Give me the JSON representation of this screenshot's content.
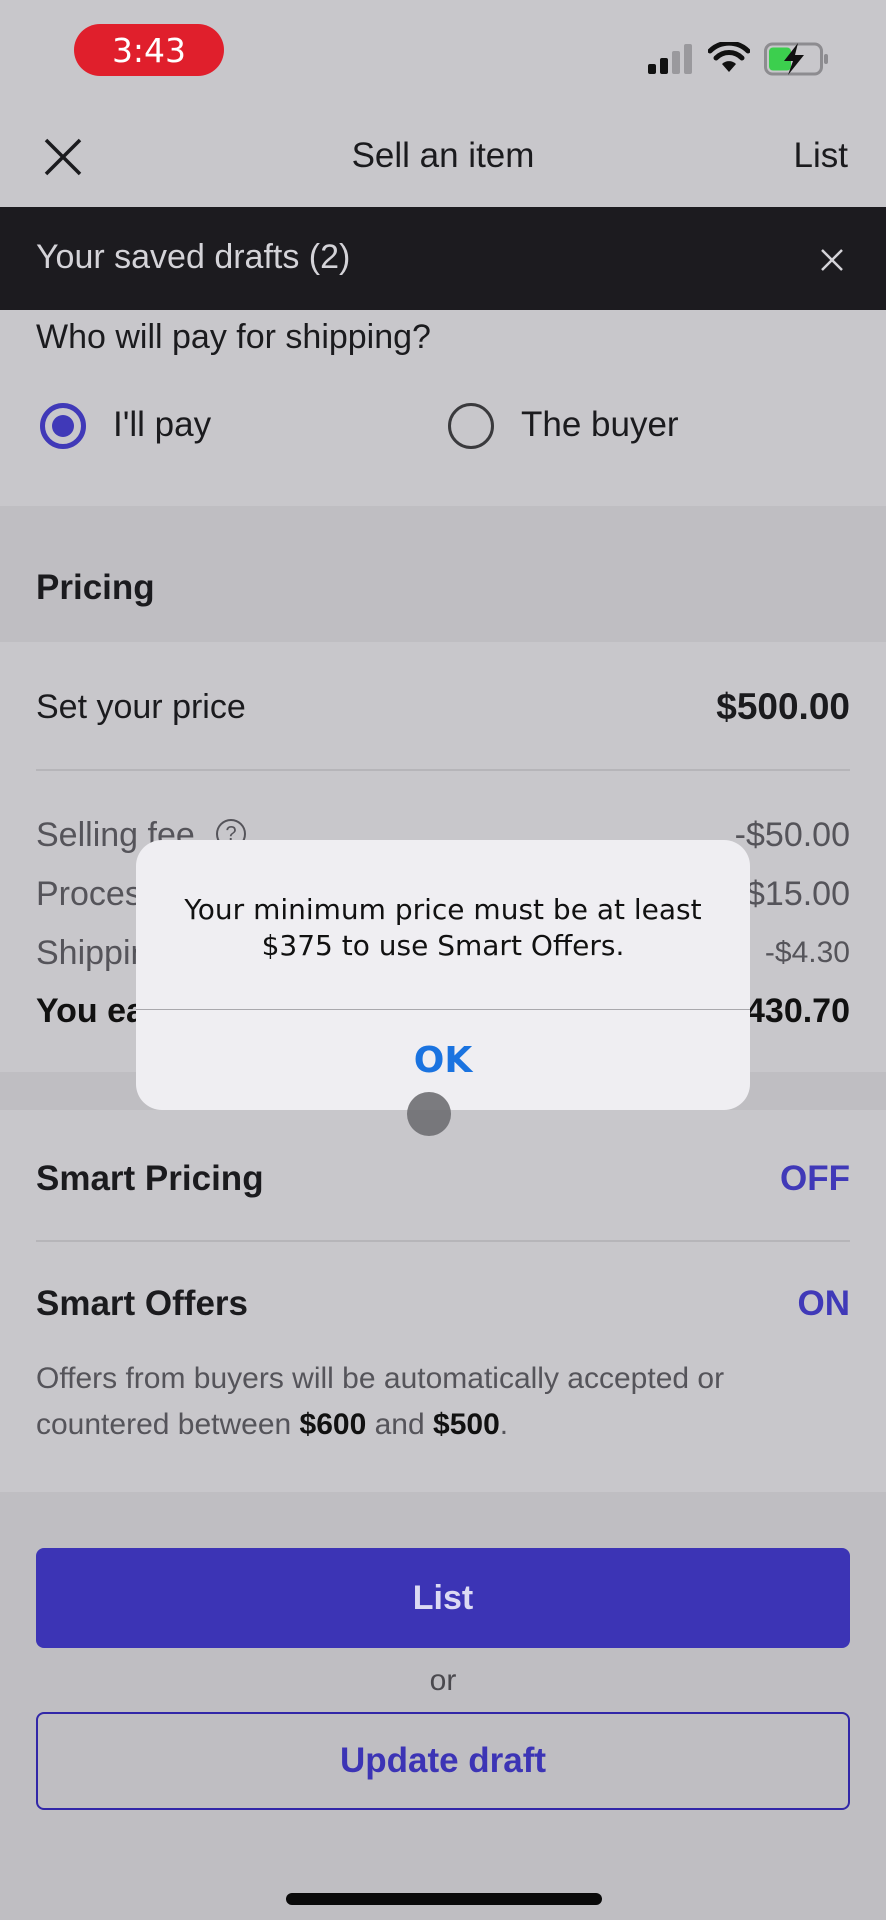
{
  "status_bar": {
    "time": "3:43",
    "signal_icon": "cellular-signal-icon",
    "wifi_icon": "wifi-icon",
    "battery_icon": "battery-charging-icon",
    "recording_color": "#e01f2c"
  },
  "nav": {
    "close_icon": "close-icon",
    "title": "Sell an item",
    "action_label": "List"
  },
  "drafts_banner": {
    "text": "Your saved drafts (2)",
    "close_icon": "close-icon"
  },
  "shipping": {
    "question": "Who will pay for shipping?",
    "options": [
      {
        "label": "I'll pay",
        "selected": true
      },
      {
        "label": "The buyer",
        "selected": false
      }
    ]
  },
  "pricing": {
    "section_title": "Pricing",
    "set_price_label": "Set your price",
    "set_price_value": "$500.00",
    "fees": [
      {
        "label": "Selling fee",
        "value": "-$50.00",
        "has_help": true
      },
      {
        "label": "Processing fee",
        "value": "-$15.00"
      },
      {
        "label": "Shipping",
        "value": "-$4.30"
      },
      {
        "label": "You earn",
        "value": "$430.70",
        "bold": true
      }
    ],
    "help_icon": "help-circle-icon"
  },
  "smart_pricing": {
    "label": "Smart Pricing",
    "value": "OFF"
  },
  "smart_offers": {
    "label": "Smart Offers",
    "value": "ON",
    "desc_prefix": "Offers from buyers will be automatically accepted or countered between ",
    "desc_high": "$600",
    "desc_mid": " and ",
    "desc_low": "$500",
    "desc_suffix": "."
  },
  "actions": {
    "list_label": "List",
    "or_label": "or",
    "update_draft_label": "Update draft"
  },
  "alert": {
    "message": "Your minimum price must be at least $375 to use Smart Offers.",
    "ok_label": "OK"
  },
  "colors": {
    "accent": "#3c34b5",
    "alert_button": "#1a73e0",
    "banner_bg": "#1c1b1f"
  }
}
